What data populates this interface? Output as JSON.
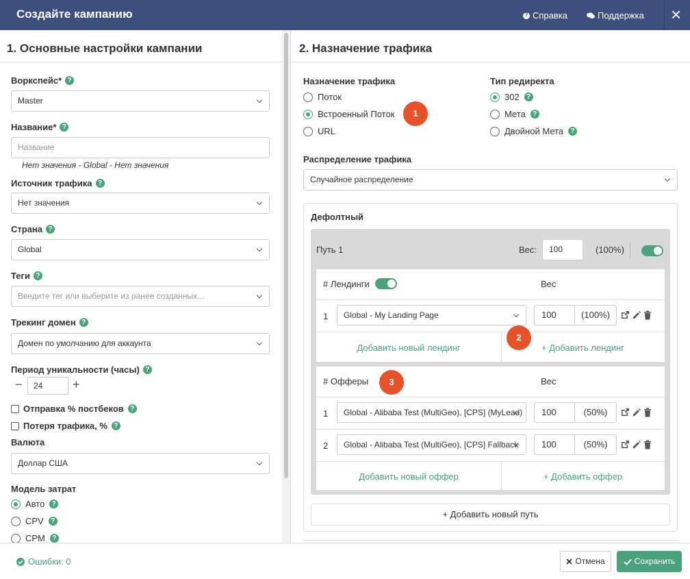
{
  "header": {
    "title": "Создайте кампанию",
    "help_label": "Справка",
    "support_label": "Поддержка",
    "close_label": "×"
  },
  "left": {
    "title": "1. Основные настройки кампании",
    "workspace": {
      "label": "Воркспейс*",
      "value": "Master"
    },
    "name": {
      "label": "Название*",
      "placeholder": "Название",
      "hint": "Нет значения - Global - Нет значения"
    },
    "traffic_source": {
      "label": "Источник трафика",
      "value": "Нет значения"
    },
    "country": {
      "label": "Страна",
      "value": "Global"
    },
    "tags": {
      "label": "Теги",
      "placeholder": "Введите тег или выберите из ранее созданных..."
    },
    "tracking_domain": {
      "label": "Трекинг домен",
      "value": "Домен по умолчанию для аккаунта"
    },
    "uniqueness": {
      "label": "Период уникальности (часы)",
      "value": "24",
      "minus": "−",
      "plus": "+"
    },
    "postback": {
      "label": "Отправка % постбеков"
    },
    "traffic_loss": {
      "label": "Потеря трафика, %"
    },
    "currency": {
      "label": "Валюта",
      "value": "Доллар США"
    },
    "cost_model": {
      "label": "Модель затрат",
      "options": [
        {
          "label": "Авто",
          "selected": true
        },
        {
          "label": "CPV",
          "selected": false
        },
        {
          "label": "CPM",
          "selected": false
        }
      ]
    }
  },
  "right": {
    "title": "2. Назначение трафика",
    "destination": {
      "label": "Назначение трафика",
      "options": [
        {
          "label": "Поток",
          "selected": false
        },
        {
          "label": "Встроенный Поток",
          "selected": true
        },
        {
          "label": "URL",
          "selected": false
        }
      ]
    },
    "redirect": {
      "label": "Тип редиректа",
      "options": [
        {
          "label": "302",
          "selected": true
        },
        {
          "label": "Мета",
          "selected": false
        },
        {
          "label": "Двойной Мета",
          "selected": false
        }
      ]
    },
    "distribution": {
      "label": "Распределение трафика",
      "value": "Случайное распределение"
    },
    "default_block": {
      "title": "Дефолтный",
      "path": {
        "name": "Путь 1",
        "weight_label": "Вес:",
        "weight": "100",
        "weight_pct": "(100%)",
        "landings": {
          "header": "# Лендинги",
          "weight_header": "Вес",
          "rows": [
            {
              "index": "1",
              "name": "Global - My Landing Page",
              "weight": "100",
              "pct": "(100%)"
            }
          ],
          "add_new": "Добавить новый лендинг",
          "add": "+ Добавить лендинг"
        },
        "offers": {
          "header": "# Офферы",
          "weight_header": "Вес",
          "rows": [
            {
              "index": "1",
              "name": "Global - Alibaba Test (MultiGeo), [CPS] (MyLead)",
              "weight": "100",
              "pct": "(50%)"
            },
            {
              "index": "2",
              "name": "Global - Alibaba Test (MultiGeo), [CPS] Fallback",
              "weight": "100",
              "pct": "(50%)"
            }
          ],
          "add_new": "Добавить новый оффер",
          "add": "+ Добавить оффер"
        }
      },
      "add_path": "+ Добавить новый путь"
    },
    "badges": [
      "1",
      "2",
      "3"
    ]
  },
  "footer": {
    "errors": "Ошибки: 0",
    "cancel": "Отмена",
    "save": "Сохранить"
  },
  "colors": {
    "header_bg": "#3d4f7e",
    "accent": "#4aa37b",
    "badge": "#e8522a"
  }
}
